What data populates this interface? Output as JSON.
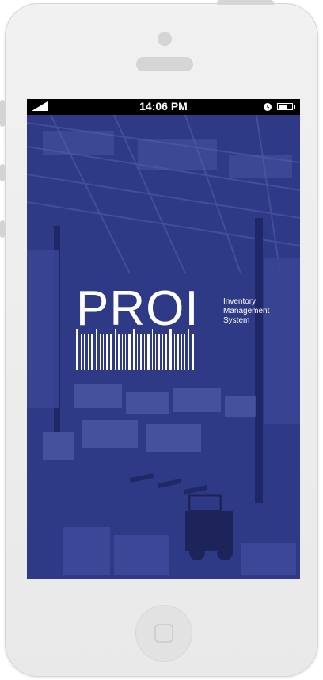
{
  "status_bar": {
    "time": "14:06 PM",
    "battery_level": 0.6
  },
  "logo": {
    "wordmark": "PROI",
    "tagline_lines": [
      "Inventory",
      "Management",
      "System"
    ]
  },
  "colors": {
    "overlay_blue": "#2e3a86",
    "phone_body": "#ececec"
  },
  "icons": [
    "signal-icon",
    "alarm-clock-icon",
    "battery-icon",
    "barcode-icon",
    "home-button-icon"
  ]
}
